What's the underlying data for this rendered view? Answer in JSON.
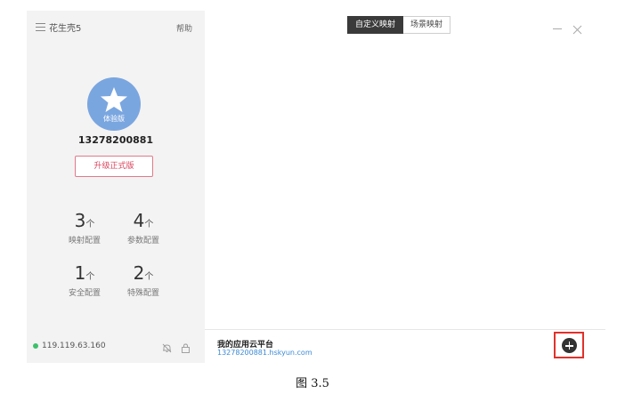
{
  "sidebar": {
    "app_name": "花生壳5",
    "help": "帮助",
    "avatar_badge": "体验版",
    "account": "13278200881",
    "upgrade_label": "升级正式版",
    "unit": "个",
    "stats": [
      {
        "value": "3",
        "label": "映射配置"
      },
      {
        "value": "4",
        "label": "参数配置"
      },
      {
        "value": "1",
        "label": "安全配置"
      },
      {
        "value": "2",
        "label": "特殊配置"
      }
    ],
    "ip": "119.119.63.160",
    "status_color": "#3cc06a"
  },
  "tabs": [
    {
      "label": "自定义映射",
      "active": true
    },
    {
      "label": "场景映射",
      "active": false
    }
  ],
  "platform": {
    "title": "我的应用云平台",
    "link": "13278200881.hskyun.com"
  },
  "caption": "图 3.5",
  "colors": {
    "accent_red": "#e0322c",
    "avatar_blue": "#7aa6e0",
    "link_blue": "#3a8ad6"
  }
}
